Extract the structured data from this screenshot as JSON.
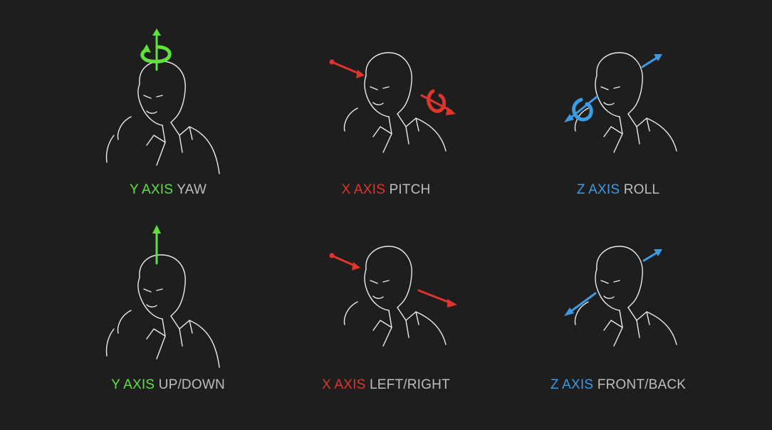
{
  "colors": {
    "background": "#1e1e1e",
    "y_axis": "#5fe03a",
    "x_axis": "#e0352b",
    "z_axis": "#3a9be6",
    "motion_text": "#bdbdbd",
    "line_art": "#ececec"
  },
  "panels": [
    {
      "axis_label": "Y AXIS",
      "motion_label": "YAW",
      "axis": "y",
      "kind": "rotate"
    },
    {
      "axis_label": "X AXIS",
      "motion_label": "PITCH",
      "axis": "x",
      "kind": "rotate"
    },
    {
      "axis_label": "Z AXIS",
      "motion_label": "ROLL",
      "axis": "z",
      "kind": "rotate"
    },
    {
      "axis_label": "Y AXIS",
      "motion_label": "UP/DOWN",
      "axis": "y",
      "kind": "translate"
    },
    {
      "axis_label": "X AXIS",
      "motion_label": "LEFT/RIGHT",
      "axis": "x",
      "kind": "translate"
    },
    {
      "axis_label": "Z AXIS",
      "motion_label": "FRONT/BACK",
      "axis": "z",
      "kind": "translate"
    }
  ]
}
